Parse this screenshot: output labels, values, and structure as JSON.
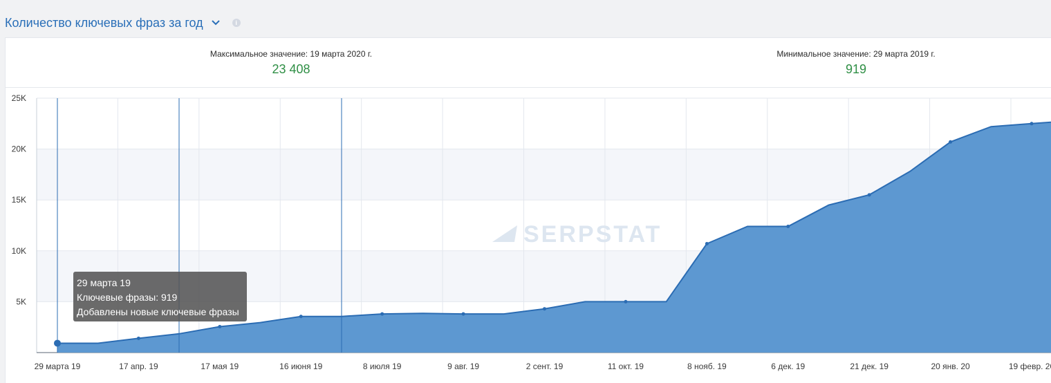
{
  "header": {
    "title": "Количество ключевых фраз за год",
    "chevron_icon": "chevron-down-icon",
    "info_icon": "info-icon"
  },
  "stats": {
    "max_label": "Максимальное значение: 19 марта 2020 г.",
    "max_value": "23 408",
    "min_label": "Минимальное значение: 29 марта 2019 г.",
    "min_value": "919"
  },
  "watermark": "SERPSTAT",
  "tooltip": {
    "date": "29 марта 19",
    "line1": "Ключевые фразы: 919",
    "line2": "Добавлены новые ключевые фразы"
  },
  "colors": {
    "area": "#5d98d1",
    "line": "#2b6cb3",
    "accent_value": "#2f8f45",
    "title": "#2a6fb8"
  },
  "chart_data": {
    "type": "area",
    "x": [
      "29 марта 19",
      "17 апр. 19",
      "17 мая 19",
      "16 июня 19",
      "8 июля 19",
      "9 авг. 19",
      "2 сент. 19",
      "11 окт. 19",
      "8 нояб. 19",
      "6 дек. 19",
      "21 дек. 19",
      "20 янв. 20",
      "19 февр. 20"
    ],
    "series": [
      {
        "values": [
          919,
          919,
          1400,
          1850,
          2550,
          2950,
          3550,
          3550,
          3800,
          3850,
          3800,
          3800,
          4300,
          5000,
          5000,
          5000,
          10700,
          12400,
          12400,
          14500,
          15500,
          17800,
          20700,
          22200,
          22500
        ]
      }
    ],
    "ylim": [
      0,
      25000
    ],
    "yticks": [
      "5K",
      "10K",
      "15K",
      "20K",
      "25K"
    ],
    "grid": true,
    "legend": "none",
    "markers": [
      "29 марта 19",
      "17 апр. 19",
      "17 мая 19",
      "16 июня 19",
      "8 июля 19",
      "9 авг. 19",
      "2 сент. 19",
      "11 окт. 19",
      "8 нояб. 19",
      "6 дек. 19",
      "21 дек. 19",
      "20 янв. 20",
      "19 февр. 20"
    ],
    "vertical_lines": [
      "29 марта 19",
      "17 апр. 19",
      "8 июля 19"
    ]
  }
}
